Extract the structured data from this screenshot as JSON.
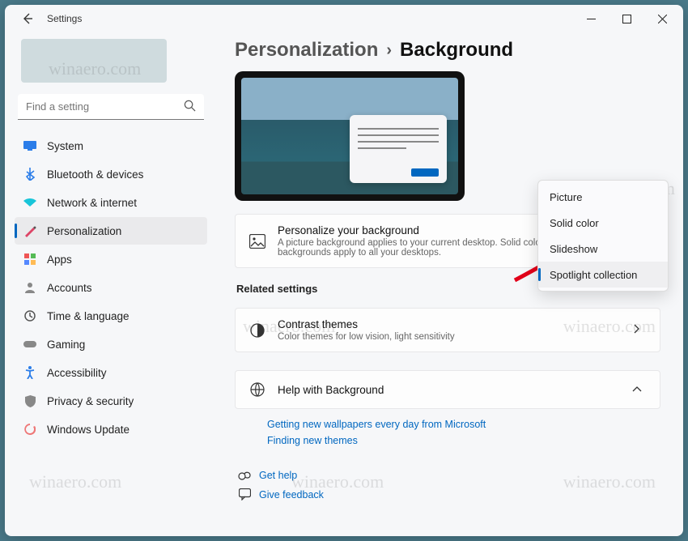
{
  "window": {
    "title": "Settings"
  },
  "search": {
    "placeholder": "Find a setting"
  },
  "sidebar": {
    "items": [
      {
        "label": "System"
      },
      {
        "label": "Bluetooth & devices"
      },
      {
        "label": "Network & internet"
      },
      {
        "label": "Personalization"
      },
      {
        "label": "Apps"
      },
      {
        "label": "Accounts"
      },
      {
        "label": "Time & language"
      },
      {
        "label": "Gaming"
      },
      {
        "label": "Accessibility"
      },
      {
        "label": "Privacy & security"
      },
      {
        "label": "Windows Update"
      }
    ],
    "selected_index": 3
  },
  "breadcrumb": {
    "parent": "Personalization",
    "current": "Background"
  },
  "cards": {
    "personalize": {
      "title": "Personalize your background",
      "desc": "A picture background applies to your current desktop. Solid color or slideshow backgrounds apply to all your desktops."
    },
    "contrast": {
      "title": "Contrast themes",
      "desc": "Color themes for low vision, light sensitivity"
    },
    "help": {
      "title": "Help with Background"
    }
  },
  "related_heading": "Related settings",
  "help_links": {
    "a": "Getting new wallpapers every day from Microsoft",
    "b": "Finding new themes"
  },
  "footer": {
    "get_help": "Get help",
    "feedback": "Give feedback"
  },
  "dropdown": {
    "options": [
      "Picture",
      "Solid color",
      "Slideshow",
      "Spotlight collection"
    ],
    "selected_index": 3
  },
  "watermark": "winaero.com"
}
